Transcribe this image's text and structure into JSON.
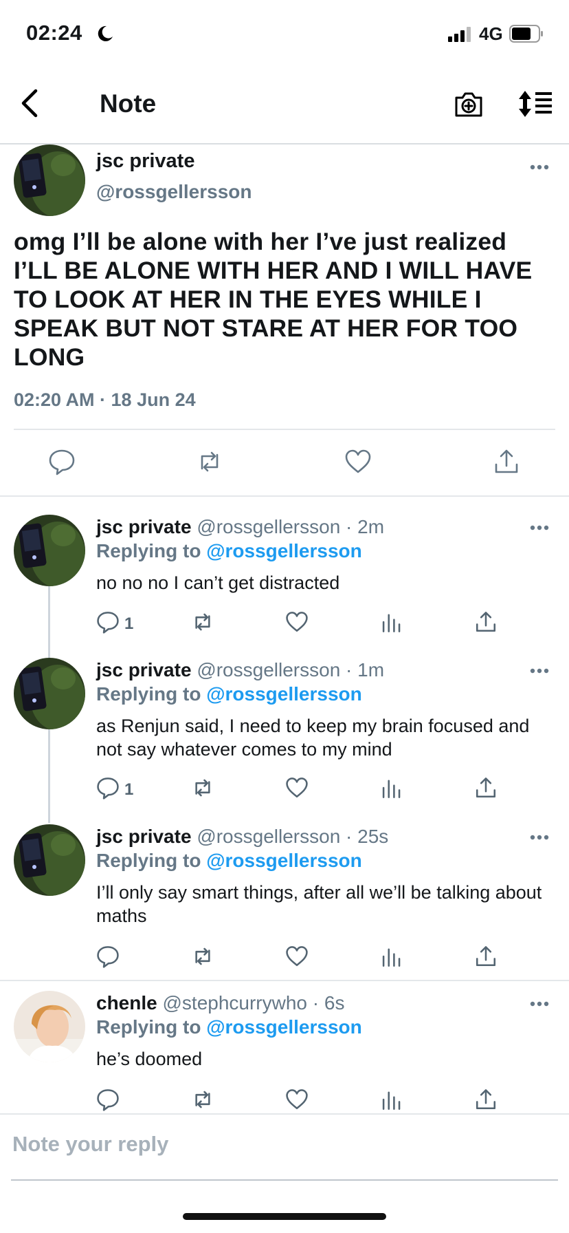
{
  "status_bar": {
    "time": "02:24",
    "network": "4G"
  },
  "nav": {
    "title": "Note"
  },
  "main_tweet": {
    "name": "jsc private",
    "handle": "@rossgellersson",
    "text": "omg I’ll be alone with her I’ve just realized I’LL BE ALONE WITH HER AND I WILL HAVE TO LOOK AT HER IN THE EYES WHILE I SPEAK BUT NOT STARE AT HER FOR TOO LONG",
    "timestamp": "02:20 AM · 18 Jun 24"
  },
  "replies": [
    {
      "name": "jsc private",
      "handle_time": "@rossgellersson · 2m",
      "replying_label": "Replying to",
      "replying_to": "@rossgellersson",
      "text": "no no no I can’t get distracted",
      "reply_count": "1"
    },
    {
      "name": "jsc private",
      "handle_time": "@rossgellersson · 1m",
      "replying_label": "Replying to",
      "replying_to": "@rossgellersson",
      "text": "as Renjun said, I need to keep my brain focused and not say whatever comes to my mind",
      "reply_count": "1"
    },
    {
      "name": "jsc private",
      "handle_time": "@rossgellersson · 25s",
      "replying_label": "Replying to",
      "replying_to": "@rossgellersson",
      "text": "I’ll only say smart things, after all we’ll be talking about maths",
      "reply_count": ""
    },
    {
      "name": "chenle",
      "handle_time": "@stephcurrywho · 6s",
      "replying_label": "Replying to",
      "replying_to": "@rossgellersson",
      "text": "he’s doomed",
      "reply_count": ""
    }
  ],
  "composer": {
    "placeholder": "Note your reply"
  },
  "icons": {
    "back": "chevron-left-icon",
    "camera": "camera-plus-icon",
    "sort": "sort-icon",
    "reply": "speech-bubble-icon",
    "retweet": "retweet-icon",
    "like": "heart-icon",
    "views": "bar-chart-icon",
    "share": "share-icon",
    "more": "more-dots-icon"
  },
  "colors": {
    "link": "#1d9bf0",
    "secondary": "#657786",
    "text": "#14171a"
  }
}
